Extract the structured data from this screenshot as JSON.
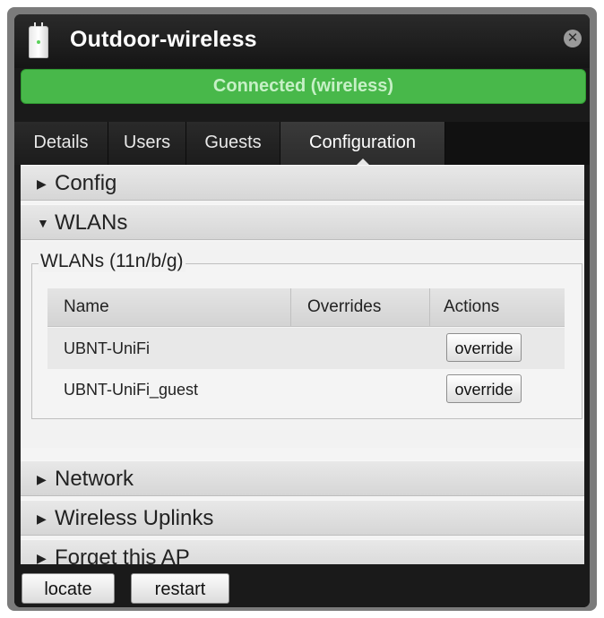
{
  "window": {
    "title": "Outdoor-wireless",
    "close_icon": "close-icon",
    "device_icon": "access-point-icon"
  },
  "status": {
    "text": "Connected (wireless)",
    "color": "#48b84a"
  },
  "tabs": [
    {
      "label": "Details",
      "active": false
    },
    {
      "label": "Users",
      "active": false
    },
    {
      "label": "Guests",
      "active": false
    },
    {
      "label": "Configuration",
      "active": true
    }
  ],
  "sections": {
    "config": {
      "label": "Config",
      "expanded": false
    },
    "wlans": {
      "label": "WLANs",
      "expanded": true
    },
    "network": {
      "label": "Network",
      "expanded": false
    },
    "wireless_uplinks": {
      "label": "Wireless Uplinks",
      "expanded": false
    },
    "forget": {
      "label": "Forget this AP",
      "expanded": false
    }
  },
  "wlans": {
    "group_title": "WLANs (11n/b/g)",
    "columns": [
      "Name",
      "Overrides",
      "Actions"
    ],
    "rows": [
      {
        "name": "UBNT-UniFi",
        "overrides": "",
        "action": "override"
      },
      {
        "name": "UBNT-UniFi_guest",
        "overrides": "",
        "action": "override"
      }
    ]
  },
  "footer": {
    "locate_label": "locate",
    "restart_label": "restart"
  }
}
